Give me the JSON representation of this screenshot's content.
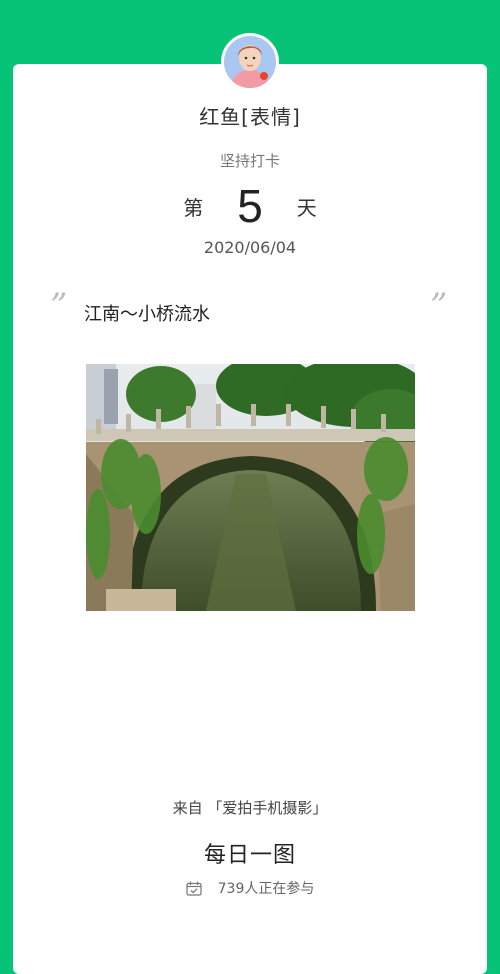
{
  "user": {
    "name": "红鱼[表情]"
  },
  "streak": {
    "label": "坚持打卡",
    "prefix": "第",
    "number": "5",
    "suffix": "天"
  },
  "post": {
    "date": "2020/06/04",
    "quote_open": "”",
    "quote_close": "”",
    "caption": "江南～小桥流水"
  },
  "footer": {
    "source": "来自 「爱拍手机摄影」",
    "topic": "每日一图",
    "participants": "739人正在参与"
  },
  "icons": {
    "calendar": "calendar-check-icon"
  },
  "colors": {
    "background": "#07c377",
    "card": "#ffffff"
  }
}
